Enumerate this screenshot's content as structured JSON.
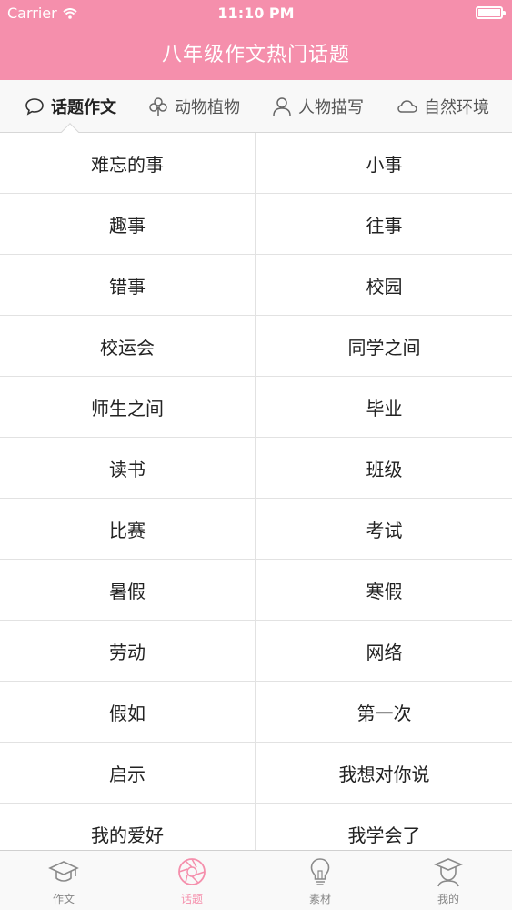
{
  "status_bar": {
    "carrier": "Carrier",
    "time": "11:10 PM"
  },
  "header": {
    "title": "八年级作文热门话题"
  },
  "tabs": [
    {
      "label": "话题作文",
      "icon": "speech-bubble-icon",
      "active": true
    },
    {
      "label": "动物植物",
      "icon": "clover-icon",
      "active": false
    },
    {
      "label": "人物描写",
      "icon": "person-icon",
      "active": false
    },
    {
      "label": "自然环境",
      "icon": "cloud-icon",
      "active": false
    }
  ],
  "topics": [
    [
      "难忘的事",
      "小事"
    ],
    [
      "趣事",
      "往事"
    ],
    [
      "错事",
      "校园"
    ],
    [
      "校运会",
      "同学之间"
    ],
    [
      "师生之间",
      "毕业"
    ],
    [
      "读书",
      "班级"
    ],
    [
      "比赛",
      "考试"
    ],
    [
      "暑假",
      "寒假"
    ],
    [
      "劳动",
      "网络"
    ],
    [
      "假如",
      "第一次"
    ],
    [
      "启示",
      "我想对你说"
    ],
    [
      "我的爱好",
      "我学会了"
    ]
  ],
  "tabbar": [
    {
      "label": "作文",
      "icon": "graduation-cap-icon",
      "active": false
    },
    {
      "label": "话题",
      "icon": "aperture-icon",
      "active": true
    },
    {
      "label": "素材",
      "icon": "lightbulb-icon",
      "active": false
    },
    {
      "label": "我的",
      "icon": "student-avatar-icon",
      "active": false
    }
  ],
  "colors": {
    "accent": "#f58fac",
    "divider": "#e2e2e2"
  }
}
